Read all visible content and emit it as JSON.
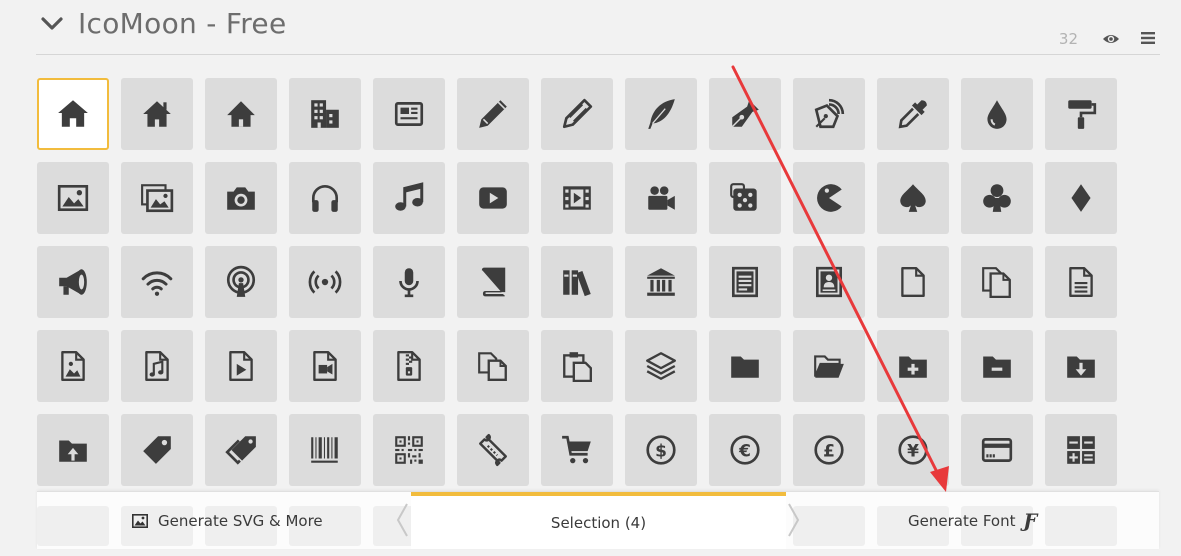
{
  "header": {
    "title": "IcoMoon - Free",
    "count": "32"
  },
  "grid": {
    "rows": [
      [
        "home-icon",
        "home2-icon",
        "home3-icon",
        "office-icon",
        "newspaper-icon",
        "pencil-icon",
        "pencil2-icon",
        "quill-icon",
        "pen-icon",
        "blog-icon",
        "eyedropper-icon",
        "droplet-icon",
        "paint-format-icon"
      ],
      [
        "image-icon",
        "images-icon",
        "camera-icon",
        "headphones-icon",
        "music-icon",
        "play-icon",
        "film-icon",
        "video-camera-icon",
        "dice-icon",
        "pacman-icon",
        "spades-icon",
        "clubs-icon",
        "diamonds-icon"
      ],
      [
        "bullhorn-icon",
        "connection-icon",
        "podcast-icon",
        "feed-icon",
        "mic-icon",
        "book-icon",
        "books-icon",
        "library-icon",
        "file-text-icon",
        "profile-icon",
        "file-empty-icon",
        "files-empty-icon",
        "file-text2-icon"
      ],
      [
        "file-picture-icon",
        "file-music-icon",
        "file-play-icon",
        "file-video-icon",
        "file-zip-icon",
        "copy-icon",
        "paste-icon",
        "stack-icon",
        "folder-icon",
        "folder-open-icon",
        "folder-plus-icon",
        "folder-minus-icon",
        "folder-download-icon"
      ],
      [
        "folder-upload-icon",
        "price-tag-icon",
        "price-tags-icon",
        "barcode-icon",
        "qrcode-icon",
        "ticket-icon",
        "cart-icon",
        "coin-dollar-icon",
        "coin-euro-icon",
        "coin-pound-icon",
        "coin-yen-icon",
        "credit-card-icon",
        "calculator-icon"
      ]
    ],
    "selected_index": 0
  },
  "bottom_bar": {
    "generate_svg_label": "Generate SVG & More",
    "selection_label": "Selection (4)",
    "generate_font_label": "Generate Font",
    "font_glyph": "Ƒ"
  },
  "colors": {
    "accent": "#f2bc3d",
    "icon": "#3d3d3d",
    "tile": "#dcdcdc",
    "annotation_arrow": "#e8393b"
  }
}
